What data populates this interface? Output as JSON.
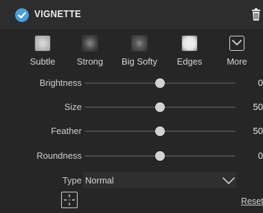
{
  "panel": {
    "title": "VIGNETTE",
    "enabled": true,
    "accent_color": "#4a9fd8"
  },
  "presets": [
    {
      "label": "Subtle",
      "icon": "subtle-vignette-thumbnail"
    },
    {
      "label": "Strong",
      "icon": "strong-vignette-thumbnail"
    },
    {
      "label": "Big Softy",
      "icon": "big-softy-vignette-thumbnail"
    },
    {
      "label": "Edges",
      "icon": "edges-vignette-thumbnail"
    },
    {
      "label": "More",
      "icon": "chevron-down-box-icon"
    }
  ],
  "sliders": [
    {
      "label": "Brightness",
      "value": "0",
      "fraction": 0.5
    },
    {
      "label": "Size",
      "value": "50",
      "fraction": 0.5
    },
    {
      "label": "Feather",
      "value": "50",
      "fraction": 0.5
    },
    {
      "label": "Roundness",
      "value": "0",
      "fraction": 0.5
    }
  ],
  "type": {
    "label": "Type",
    "value": "Normal"
  },
  "footer": {
    "reset_label": "Reset",
    "center_icon": "crosshair-target-icon"
  }
}
